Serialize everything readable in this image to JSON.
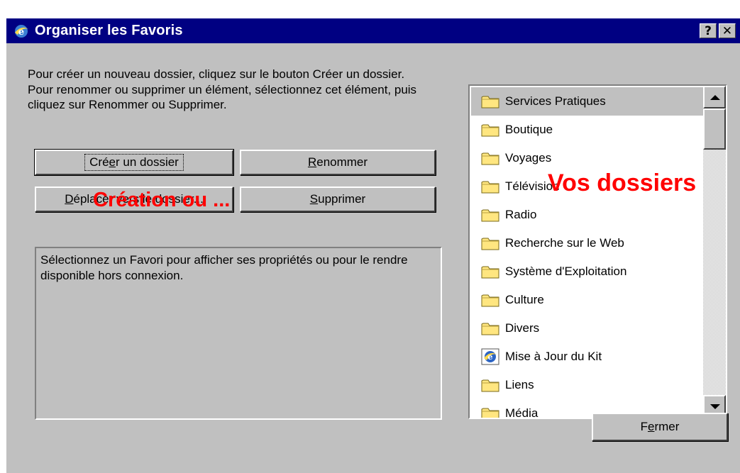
{
  "window": {
    "title": "Organiser les Favoris",
    "help_label": "?",
    "close_label": "✕"
  },
  "description": "Pour créer un nouveau dossier, cliquez sur le bouton Créer un dossier. Pour renommer ou supprimer un élément, sélectionnez cet élément, puis cliquez sur Renommer ou Supprimer.",
  "buttons": {
    "create_folder": {
      "pre": "Cré",
      "mnemonic": "e",
      "post": "r un dossier"
    },
    "rename": {
      "pre": "",
      "mnemonic": "R",
      "post": "enommer"
    },
    "move_to_folder": {
      "pre": "",
      "mnemonic": "D",
      "post": "éplacer vers le dossier..."
    },
    "delete": {
      "pre": "",
      "mnemonic": "S",
      "post": "upprimer"
    },
    "close": {
      "pre": "F",
      "mnemonic": "e",
      "post": "rmer"
    }
  },
  "properties_text": "Sélectionnez un Favori pour afficher ses propriétés ou pour le rendre disponible hors connexion.",
  "folders": [
    {
      "label": "Services Pratiques",
      "icon": "folder-icon",
      "selected": true
    },
    {
      "label": "Boutique",
      "icon": "folder-icon"
    },
    {
      "label": "Voyages",
      "icon": "folder-icon"
    },
    {
      "label": "Télévision",
      "icon": "folder-icon"
    },
    {
      "label": "Radio",
      "icon": "folder-icon"
    },
    {
      "label": "Recherche sur le Web",
      "icon": "folder-icon"
    },
    {
      "label": "Système d'Exploitation",
      "icon": "folder-icon"
    },
    {
      "label": "Culture",
      "icon": "folder-icon"
    },
    {
      "label": "Divers",
      "icon": "folder-icon"
    },
    {
      "label": "Mise à Jour du Kit",
      "icon": "ie-link-icon"
    },
    {
      "label": "Liens",
      "icon": "folder-icon"
    },
    {
      "label": "Média",
      "icon": "folder-icon"
    }
  ],
  "annotations": {
    "creation": "Création ou ...",
    "dossiers": "Vos dossiers"
  },
  "colors": {
    "titlebar": "#000082",
    "face": "#c0c0c0",
    "annotation": "#ff0000",
    "folder": "#ffe680"
  }
}
